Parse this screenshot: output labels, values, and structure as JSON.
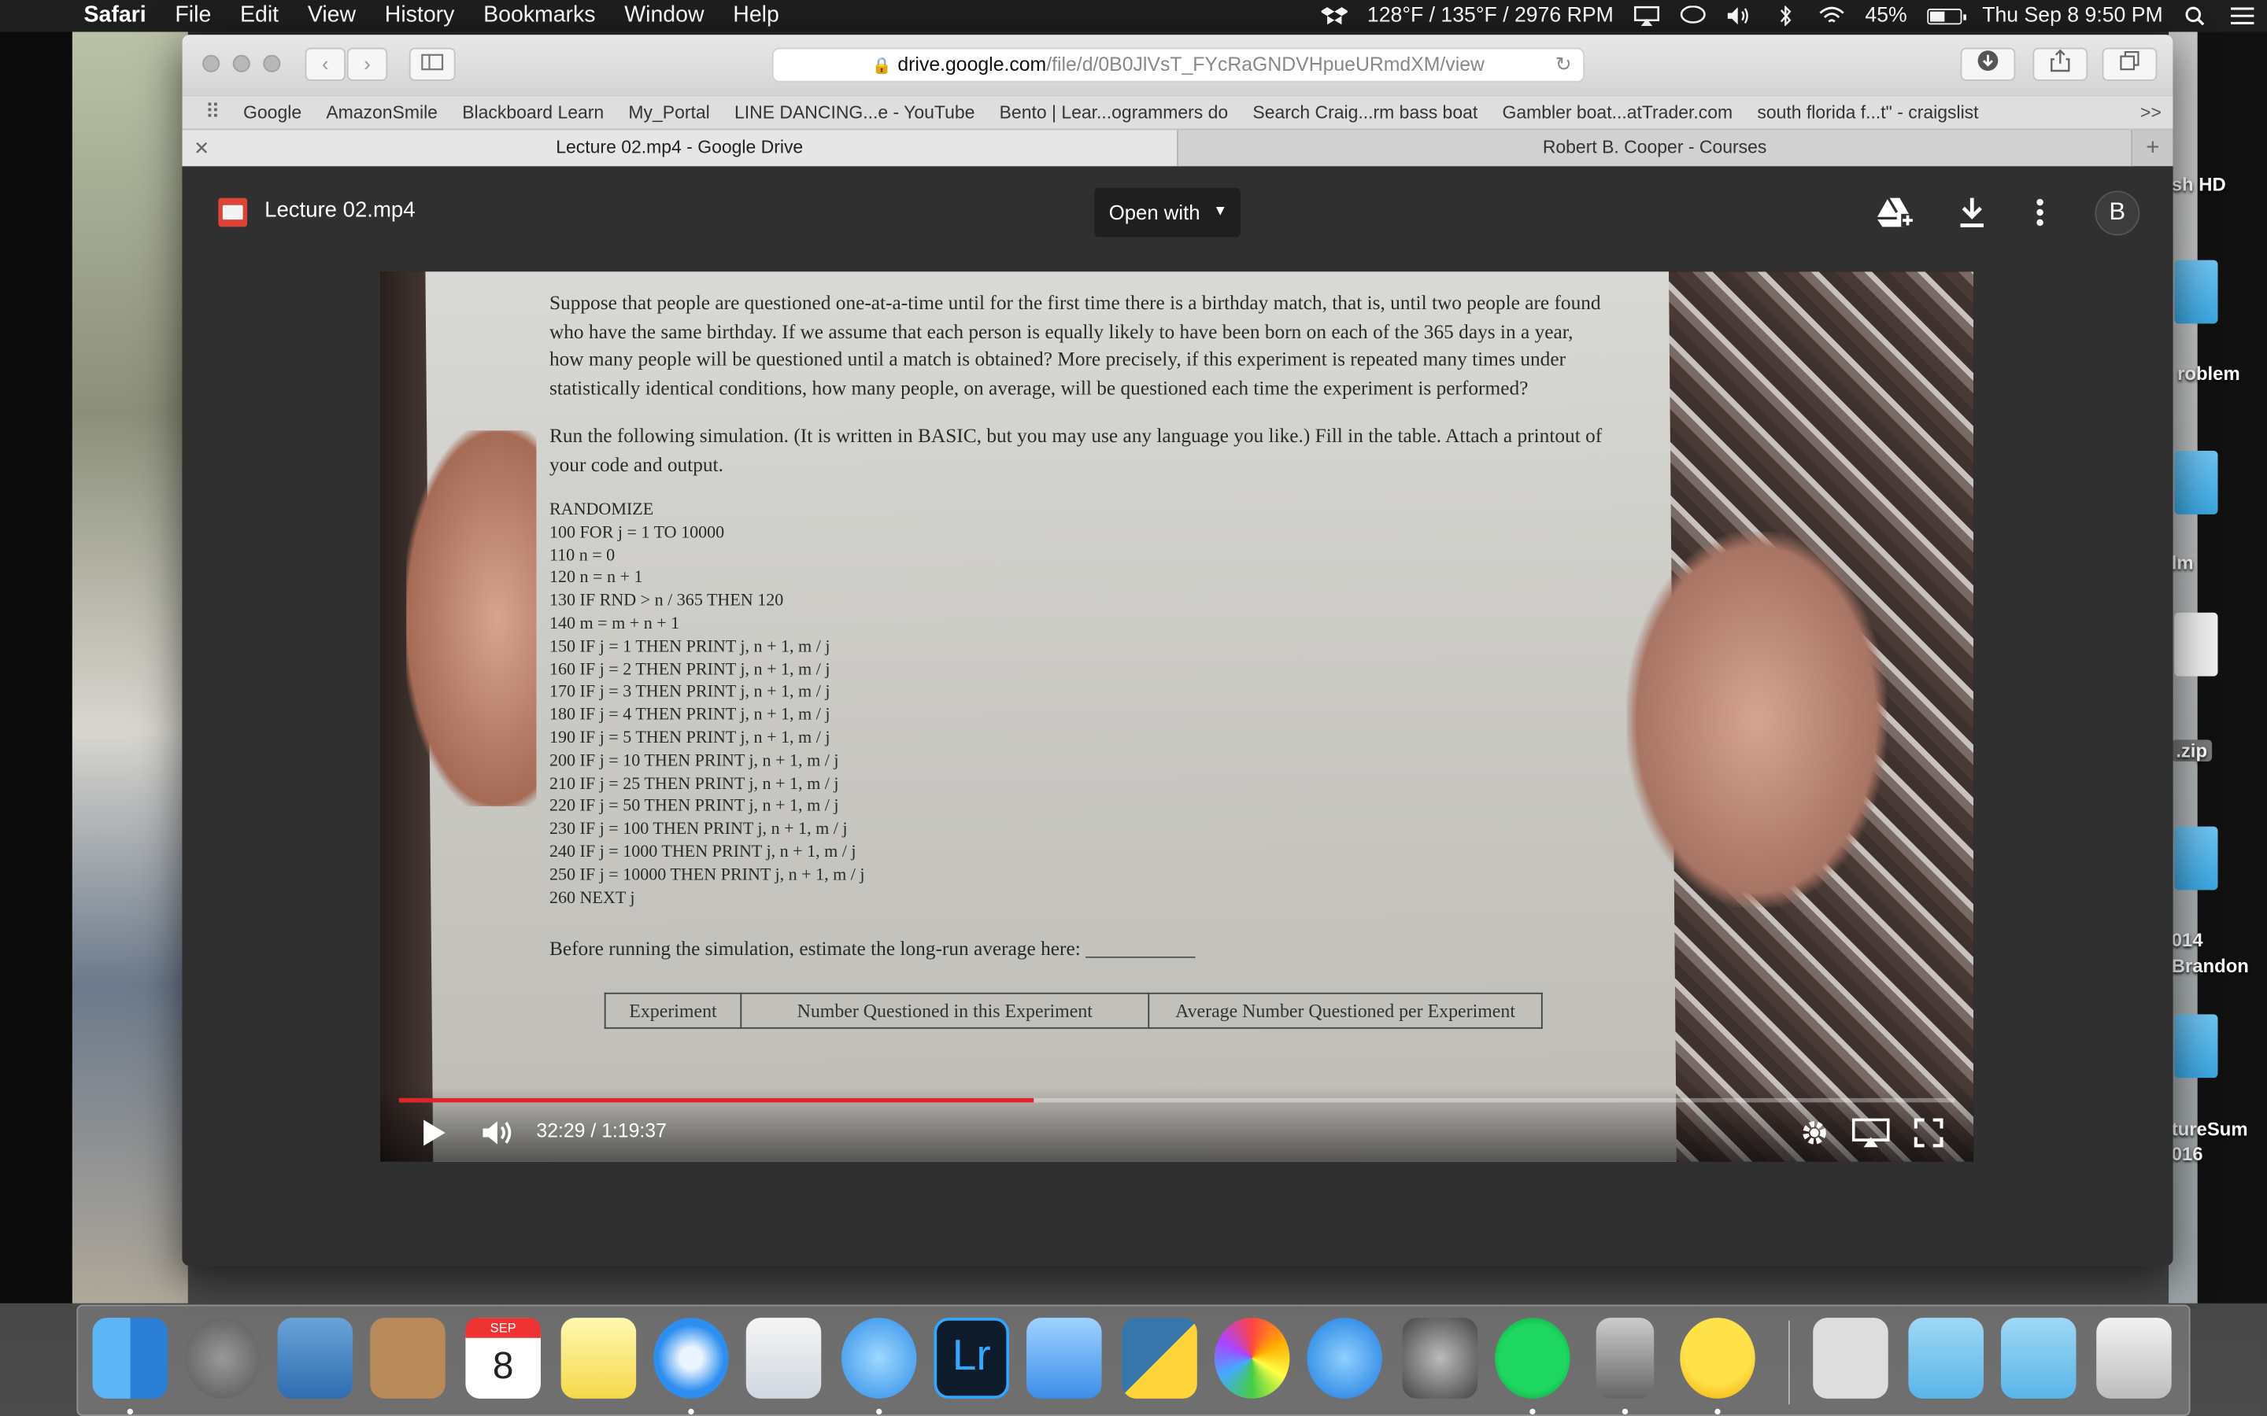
{
  "menubar": {
    "app_name": "Safari",
    "items": [
      "File",
      "Edit",
      "View",
      "History",
      "Bookmarks",
      "Window",
      "Help"
    ],
    "temps": "128°F / 135°F / 2976 RPM",
    "battery": "45%",
    "datetime": "Thu Sep 8  9:50 PM"
  },
  "browser": {
    "url_host": "drive.google.com",
    "url_path": "/file/d/0B0JlVsT_FYcRaGNDVHpueURmdXM/view",
    "bookmarks": [
      "Google",
      "AmazonSmile",
      "Blackboard Learn",
      "My_Portal",
      "LINE DANCING...e - YouTube",
      "Bento | Lear...ogrammers do",
      "Search Craig...rm bass boat",
      "Gambler boat...atTrader.com",
      "south florida f...t\" - craigslist"
    ],
    "bookmarks_more": ">>",
    "tabs": [
      {
        "label": "Lecture 02.mp4 - Google Drive",
        "active": true
      },
      {
        "label": "Robert B. Cooper - Courses",
        "active": false
      }
    ]
  },
  "viewer": {
    "file_name": "Lecture 02.mp4",
    "open_with": "Open with",
    "avatar_letter": "B",
    "time_display": "32:29 / 1:19:37",
    "progress": 0.408
  },
  "document": {
    "paragraph1": "Suppose that people are questioned one-at-a-time until for the first time there is a birthday match, that is, until two people are found who have the same birthday. If we assume that each person is equally likely to have been born on each of the 365 days in a year, how many people will be questioned until a match is obtained? More precisely, if this experiment is repeated many times under statistically identical conditions, how many people, on average, will be questioned each time the experiment is performed?",
    "paragraph2": "Run the following simulation. (It is written in BASIC, but you may use any language you like.) Fill in the table. Attach a printout of your code and output.",
    "code_lines": [
      "RANDOMIZE",
      "100 FOR j = 1 TO 10000",
      "110 n = 0",
      "120 n = n + 1",
      "130 IF RND > n / 365 THEN 120",
      "140 m = m + n + 1",
      "150 IF j = 1 THEN PRINT j, n + 1, m / j",
      "160 IF j = 2 THEN PRINT j, n + 1, m / j",
      "170 IF j = 3 THEN PRINT j, n + 1, m / j",
      "180 IF j = 4 THEN PRINT j, n + 1, m / j",
      "190 IF j = 5 THEN PRINT j, n + 1, m / j",
      "200 IF j = 10 THEN PRINT j, n + 1, m / j",
      "210 IF j = 25 THEN PRINT j, n + 1, m / j",
      "220 IF j = 50 THEN PRINT j, n + 1, m / j",
      "230 IF j = 100 THEN PRINT j, n + 1, m / j",
      "240 IF j = 1000 THEN PRINT j, n + 1, m / j",
      "250 IF j = 10000 THEN PRINT j, n + 1, m / j",
      "260 NEXT j"
    ],
    "estimate_line": "Before running the simulation, estimate the long-run average here:  ___________",
    "table_headers": [
      "Experiment",
      "Number Questioned in this Experiment",
      "Average Number Questioned per Experiment"
    ]
  },
  "desktop": {
    "labels": [
      "sh HD",
      "roblem",
      "lm",
      ".zip",
      "014",
      "Brandon",
      "tureSum",
      "016"
    ]
  },
  "dock": {
    "calendar_month": "SEP",
    "calendar_day": "8",
    "lightroom": "Lr"
  }
}
